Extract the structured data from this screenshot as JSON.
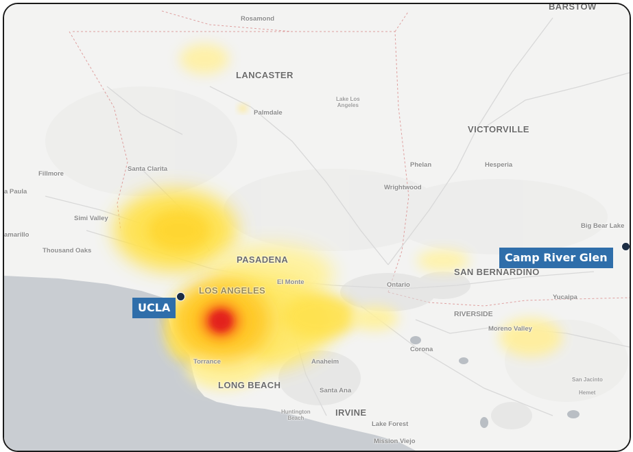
{
  "map": {
    "colors": {
      "land": "#f3f3f2",
      "water": "#c9cdd2",
      "heat_low": "#fff7a8",
      "heat_mid": "#ffd426",
      "heat_high": "#e8241d",
      "marker_label_bg": "#2f6eaa",
      "marker_dot": "#1c2d44"
    },
    "markers": [
      {
        "label": "UCLA"
      },
      {
        "label": "Camp River Glen"
      }
    ],
    "places": {
      "barstow": "BARSTOW",
      "rosamond": "Rosamond",
      "lancaster": "LANCASTER",
      "lake_los_angeles": "Lake Los\nAngeles",
      "palmdale": "Palmdale",
      "victorville": "VICTORVILLE",
      "fillmore": "Fillmore",
      "santa_clarita": "Santa Clarita",
      "phelan": "Phelan",
      "hesperia": "Hesperia",
      "santa_paula": "a Paula",
      "wrightwood": "Wrightwood",
      "simi_valley": "Simi Valley",
      "big_bear_lake": "Big Bear Lake",
      "camarillo": "amarillo",
      "thousand_oaks": "Thousand Oaks",
      "pasadena": "PASADENA",
      "san_bernardino": "SAN BERNARDINO",
      "el_monte": "El Monte",
      "los_angeles": "LOS ANGELES",
      "ontario": "Ontario",
      "yucaipa": "Yucaipa",
      "riverside": "RIVERSIDE",
      "moreno_valley": "Moreno Valley",
      "corona": "Corona",
      "torrance": "Torrance",
      "anaheim": "Anaheim",
      "long_beach": "LONG BEACH",
      "santa_ana": "Santa Ana",
      "san_jacinto": "San Jacinto",
      "hemet": "Hemet",
      "huntington_beach": "Huntington\nBeach",
      "irvine": "IRVINE",
      "lake_forest": "Lake Forest",
      "mission_viejo": "Mission Viejo"
    }
  }
}
